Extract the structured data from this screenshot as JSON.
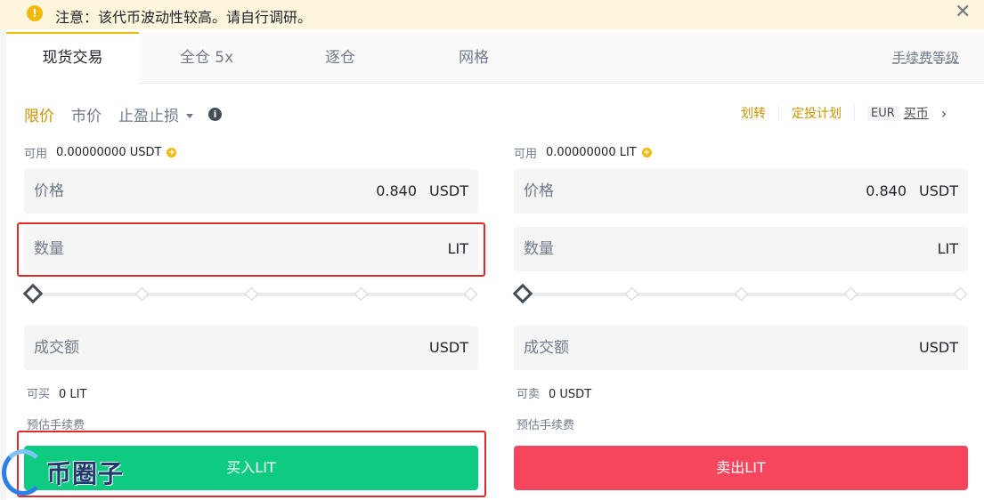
{
  "notice": {
    "text": "注意：该代币波动性较高。请自行调研。",
    "close": "✕"
  },
  "tabs": [
    {
      "label": "现货交易",
      "active": true
    },
    {
      "label": "全仓 5x",
      "active": false
    },
    {
      "label": "逐仓",
      "active": false
    },
    {
      "label": "网格",
      "active": false
    }
  ],
  "fee_level": "手续费等级",
  "order_types": {
    "limit": "限价",
    "market": "市价",
    "stop": "止盈止损"
  },
  "top_links": {
    "transfer": "划转",
    "recurring": "定投计划",
    "currency": "EUR",
    "buy_crypto": "买币"
  },
  "buy": {
    "available_label": "可用",
    "available_value": "0.00000000 USDT",
    "price_label": "价格",
    "price_value": "0.840",
    "price_unit": "USDT",
    "amount_label": "数量",
    "amount_unit": "LIT",
    "total_label": "成交额",
    "total_unit": "USDT",
    "can_label": "可买",
    "can_value": "0 LIT",
    "fee_label": "预估手续费",
    "button": "买入LIT",
    "slider_percent": 0
  },
  "sell": {
    "available_label": "可用",
    "available_value": "0.00000000 LIT",
    "price_label": "价格",
    "price_value": "0.840",
    "price_unit": "USDT",
    "amount_label": "数量",
    "amount_unit": "LIT",
    "total_label": "成交额",
    "total_unit": "USDT",
    "can_label": "可卖",
    "can_value": "0 USDT",
    "fee_label": "预估手续费",
    "button": "卖出LIT",
    "slider_percent": 0
  },
  "watermark": {
    "text": "币圈子"
  },
  "colors": {
    "accent": "#f0b90b",
    "buy": "#0ecb81",
    "sell": "#f6465d",
    "highlight": "#e02a2a"
  }
}
